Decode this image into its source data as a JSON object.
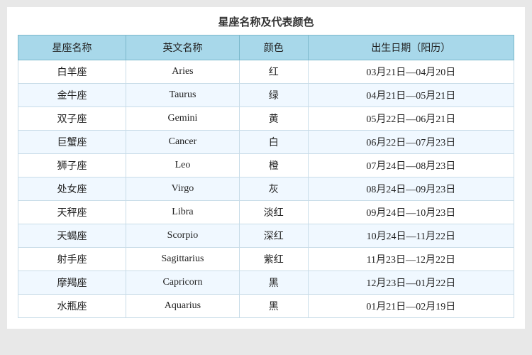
{
  "page": {
    "title": "星座名称及代表颜色"
  },
  "table": {
    "headers": [
      "星座名称",
      "英文名称",
      "颜色",
      "出生日期（阳历）"
    ],
    "rows": [
      {
        "chinese": "白羊座",
        "english": "Aries",
        "color": "红",
        "dates": "03月21日—04月20日"
      },
      {
        "chinese": "金牛座",
        "english": "Taurus",
        "color": "绿",
        "dates": "04月21日—05月21日"
      },
      {
        "chinese": "双子座",
        "english": "Gemini",
        "color": "黄",
        "dates": "05月22日—06月21日"
      },
      {
        "chinese": "巨蟹座",
        "english": "Cancer",
        "color": "白",
        "dates": "06月22日—07月23日"
      },
      {
        "chinese": "狮子座",
        "english": "Leo",
        "color": "橙",
        "dates": "07月24日—08月23日"
      },
      {
        "chinese": "处女座",
        "english": "Virgo",
        "color": "灰",
        "dates": "08月24日—09月23日"
      },
      {
        "chinese": "天秤座",
        "english": "Libra",
        "color": "淡红",
        "dates": "09月24日—10月23日"
      },
      {
        "chinese": "天蝎座",
        "english": "Scorpio",
        "color": "深红",
        "dates": "10月24日—11月22日"
      },
      {
        "chinese": "射手座",
        "english": "Sagittarius",
        "color": "紫红",
        "dates": "11月23日—12月22日"
      },
      {
        "chinese": "摩羯座",
        "english": "Capricorn",
        "color": "黑",
        "dates": "12月23日—01月22日"
      },
      {
        "chinese": "水瓶座",
        "english": "Aquarius",
        "color": "黑",
        "dates": "01月21日—02月19日"
      }
    ]
  }
}
